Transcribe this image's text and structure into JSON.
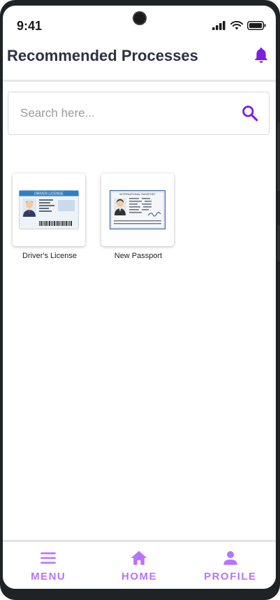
{
  "status": {
    "time": "9:41"
  },
  "header": {
    "title": "Recommended Processes"
  },
  "search": {
    "placeholder": "Search here..."
  },
  "processes": [
    {
      "label": "Driver's License",
      "card_header": "DRIVER LICENSE"
    },
    {
      "label": "New Passport",
      "card_header": "INTERNATIONAL PASSPORT"
    }
  ],
  "nav": {
    "items": [
      {
        "label": "MENU",
        "icon": "menu-icon"
      },
      {
        "label": "HOME",
        "icon": "home-icon"
      },
      {
        "label": "PROFILE",
        "icon": "person-icon"
      }
    ]
  },
  "colors": {
    "accent": "#7b1fe0",
    "nav": "#b873ff",
    "title": "#2d3142"
  }
}
